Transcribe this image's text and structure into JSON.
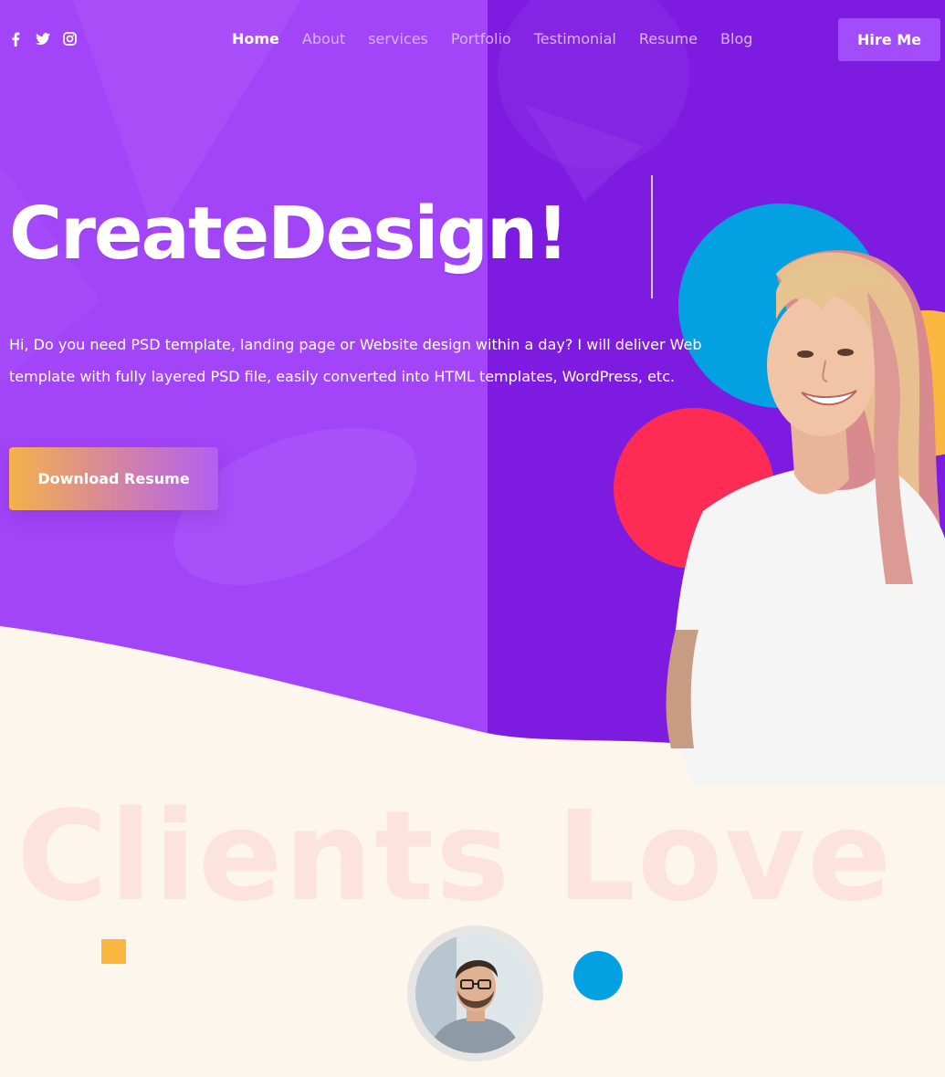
{
  "nav": {
    "social": [
      {
        "icon": "facebook-icon"
      },
      {
        "icon": "twitter-icon"
      },
      {
        "icon": "instagram-icon"
      }
    ],
    "menu": [
      {
        "label": "Home",
        "active": true
      },
      {
        "label": "About",
        "active": false
      },
      {
        "label": "services",
        "active": false
      },
      {
        "label": "Portfolio",
        "active": false
      },
      {
        "label": "Testimonial",
        "active": false
      },
      {
        "label": "Resume",
        "active": false
      },
      {
        "label": "Blog",
        "active": false
      }
    ],
    "hire_label": "Hire Me"
  },
  "hero": {
    "headline": "CreateDesign!",
    "intro": "Hi, Do you need PSD template, landing page or Website design within a day? I will deliver Web template with fully layered PSD file, easily converted into HTML templates, WordPress, etc.",
    "download_label": "Download Resume"
  },
  "clients": {
    "watermark": "Clients Love"
  },
  "colors": {
    "purple_left": "#a244f8",
    "purple_right": "#7d1ce0",
    "cream": "#fdf6ec",
    "accent_blue": "#03a1e1",
    "accent_red": "#fe2c55",
    "accent_yellow": "#fbb73f",
    "hire_button": "#a24cfb"
  }
}
